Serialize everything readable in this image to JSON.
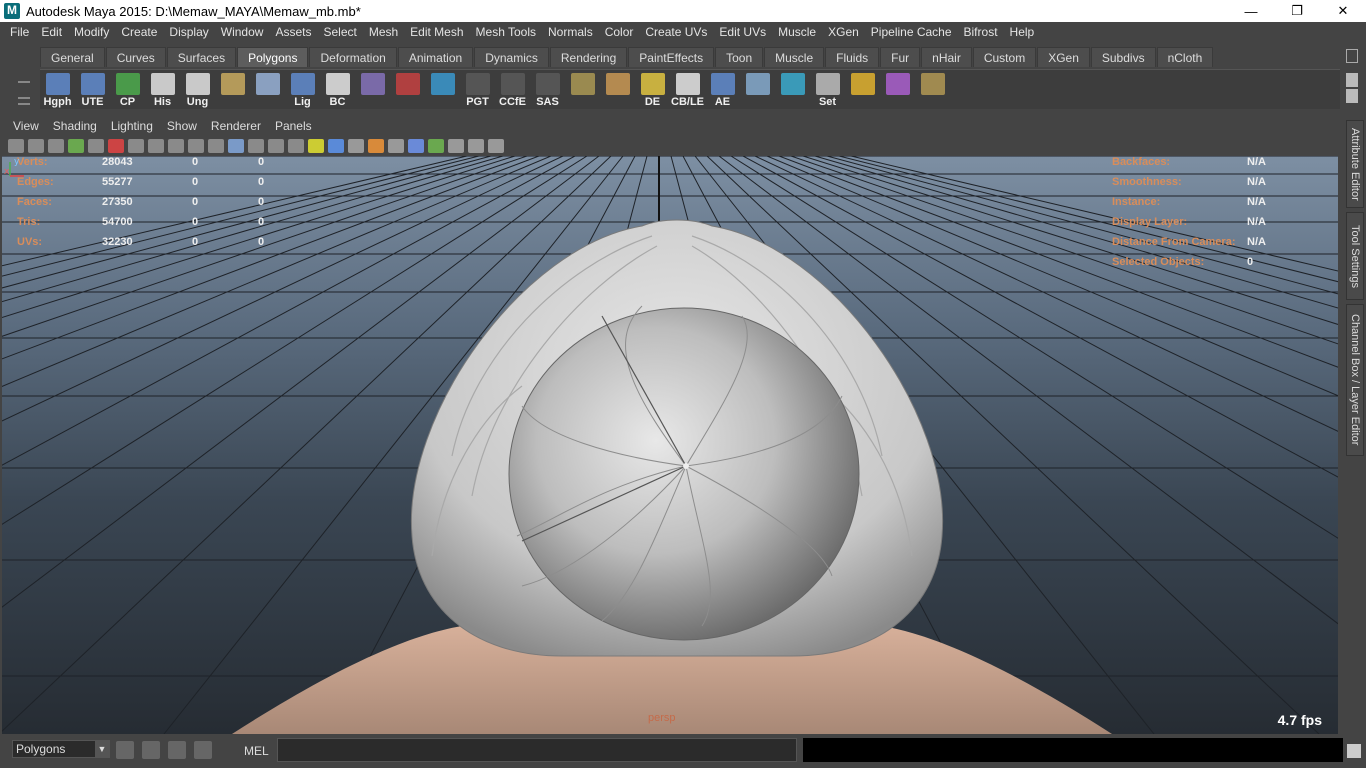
{
  "window": {
    "title": "Autodesk Maya 2015: D:\\Memaw_MAYA\\Memaw_mb.mb*",
    "controls": [
      "—",
      "❐",
      "✕"
    ]
  },
  "menu": [
    "File",
    "Edit",
    "Modify",
    "Create",
    "Display",
    "Window",
    "Assets",
    "Select",
    "Mesh",
    "Edit Mesh",
    "Mesh Tools",
    "Normals",
    "Color",
    "Create UVs",
    "Edit UVs",
    "Muscle",
    "XGen",
    "Pipeline Cache",
    "Bifrost",
    "Help"
  ],
  "shelf": {
    "tabs": [
      "General",
      "Curves",
      "Surfaces",
      "Polygons",
      "Deformation",
      "Animation",
      "Dynamics",
      "Rendering",
      "PaintEffects",
      "Toon",
      "Muscle",
      "Fluids",
      "Fur",
      "nHair",
      "Custom",
      "XGen",
      "Subdivs",
      "nCloth"
    ],
    "active_tab": "Polygons",
    "icons": [
      {
        "label": "Hgph",
        "color": "#5b7fb8"
      },
      {
        "label": "UTE",
        "color": "#5b7fb8"
      },
      {
        "label": "CP",
        "color": "#4a9a4a"
      },
      {
        "label": "His",
        "color": "#c9c9c9"
      },
      {
        "label": "Ung",
        "color": "#c9c9c9"
      },
      {
        "label": "",
        "color": "#b49a5a"
      },
      {
        "label": "",
        "color": "#8aa0c0"
      },
      {
        "label": "Lig",
        "color": "#5b7fb8"
      },
      {
        "label": "BC",
        "color": "#cccccc"
      },
      {
        "label": "",
        "color": "#7a6aa8"
      },
      {
        "label": "",
        "color": "#b04040"
      },
      {
        "label": "",
        "color": "#3a8ab8"
      },
      {
        "label": "PGT",
        "color": "#555555"
      },
      {
        "label": "CCfE",
        "color": "#555555"
      },
      {
        "label": "SAS",
        "color": "#555555"
      },
      {
        "label": "",
        "color": "#9a8a50"
      },
      {
        "label": "",
        "color": "#b48a50"
      },
      {
        "label": "DE",
        "color": "#c8b040"
      },
      {
        "label": "CB/LE",
        "color": "#cccccc"
      },
      {
        "label": "AE",
        "color": "#5b7fb8"
      },
      {
        "label": "",
        "color": "#7a9ab8"
      },
      {
        "label": "",
        "color": "#3a9ab8"
      },
      {
        "label": "Set",
        "color": "#aaaaaa"
      },
      {
        "label": "",
        "color": "#c8a030"
      },
      {
        "label": "",
        "color": "#9a5ab8"
      },
      {
        "label": "",
        "color": "#a08a50"
      }
    ]
  },
  "panel": {
    "menus": [
      "View",
      "Shading",
      "Lighting",
      "Show",
      "Renderer",
      "Panels"
    ]
  },
  "hud": {
    "left": [
      {
        "key": "Verts:",
        "v": "28043",
        "c1": "0",
        "c2": "0"
      },
      {
        "key": "Edges:",
        "v": "55277",
        "c1": "0",
        "c2": "0"
      },
      {
        "key": "Faces:",
        "v": "27350",
        "c1": "0",
        "c2": "0"
      },
      {
        "key": "Tris:",
        "v": "54700",
        "c1": "0",
        "c2": "0"
      },
      {
        "key": "UVs:",
        "v": "32230",
        "c1": "0",
        "c2": "0"
      }
    ],
    "right": [
      {
        "key": "Backfaces:",
        "v": "N/A"
      },
      {
        "key": "Smoothness:",
        "v": "N/A"
      },
      {
        "key": "Instance:",
        "v": "N/A"
      },
      {
        "key": "Display Layer:",
        "v": "N/A"
      },
      {
        "key": "Distance From Camera:",
        "v": "N/A"
      },
      {
        "key": "Selected Objects:",
        "v": "0"
      }
    ],
    "fps": "4.7 fps",
    "camera": "persp",
    "axis_y": "y",
    "axis_x": "x"
  },
  "sidetabs": [
    "Attribute Editor",
    "Tool Settings",
    "Channel Box / Layer Editor"
  ],
  "bottom": {
    "mode": "Polygons",
    "mel_label": "MEL"
  }
}
